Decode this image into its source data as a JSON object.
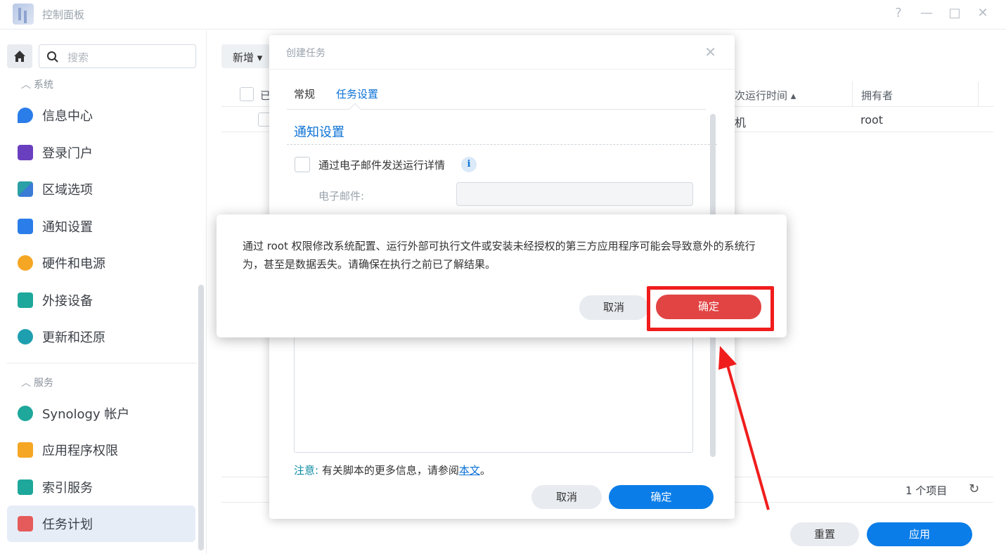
{
  "window": {
    "title": "控制面板",
    "help_icon": "?",
    "minimize_icon": "—",
    "maximize_icon": "□",
    "close_icon": "✕"
  },
  "search": {
    "placeholder": "搜索"
  },
  "sidebar": {
    "section_system": "系统",
    "section_services": "服务",
    "items": [
      {
        "label": "信息中心",
        "icon": "info-icon",
        "color": "#2b7de9"
      },
      {
        "label": "登录门户",
        "icon": "portal-icon",
        "color": "#6a3fbf"
      },
      {
        "label": "区域选项",
        "icon": "region-icon",
        "color": "#2aa0a6"
      },
      {
        "label": "通知设置",
        "icon": "notification-icon",
        "color": "#2b7de9"
      },
      {
        "label": "硬件和电源",
        "icon": "bulb-icon",
        "color": "#f5a623"
      },
      {
        "label": "外接设备",
        "icon": "external-device-icon",
        "color": "#1ea79b"
      },
      {
        "label": "更新和还原",
        "icon": "update-icon",
        "color": "#1e9fb0"
      },
      {
        "label": "Synology 帐户",
        "icon": "account-icon",
        "color": "#1ea79b"
      },
      {
        "label": "应用程序权限",
        "icon": "lock-icon",
        "color": "#f5a623"
      },
      {
        "label": "索引服务",
        "icon": "index-icon",
        "color": "#1ea79b"
      },
      {
        "label": "任务计划",
        "icon": "calendar-icon",
        "color": "#e55b5b"
      }
    ]
  },
  "toolbar": {
    "new_label": "新增 ▾"
  },
  "table": {
    "headers": {
      "enabled": "已",
      "next_run": "次运行时间 ▴",
      "owner": "拥有者"
    },
    "rows": [
      {
        "next_run": "机",
        "owner": "root"
      }
    ]
  },
  "footer": {
    "count": "1 个项目",
    "refresh_icon": "↻",
    "reset_label": "重置",
    "apply_label": "应用"
  },
  "dialog": {
    "title": "创建任务",
    "close_icon": "✕",
    "tabs": [
      "常规",
      "任务设置"
    ],
    "section_title": "通知设置",
    "email_checkbox_label": "通过电子邮件发送运行详情",
    "info_icon": "i",
    "email_label": "电子邮件:",
    "note_prefix": "注意:",
    "note_text": "有关脚本的更多信息，请参阅",
    "note_link": "本文",
    "note_suffix": "。",
    "cancel_label": "取消",
    "ok_label": "确定"
  },
  "warning": {
    "message": "通过 root 权限修改系统配置、运行外部可执行文件或安装未经授权的第三方应用程序可能会导致意外的系统行为，甚至是数据丢失。请确保在执行之前已了解结果。",
    "cancel_label": "取消",
    "ok_label": "确定"
  },
  "colors": {
    "accent": "#0b7de8",
    "danger": "#e24444",
    "annotation": "#f01d1d"
  }
}
